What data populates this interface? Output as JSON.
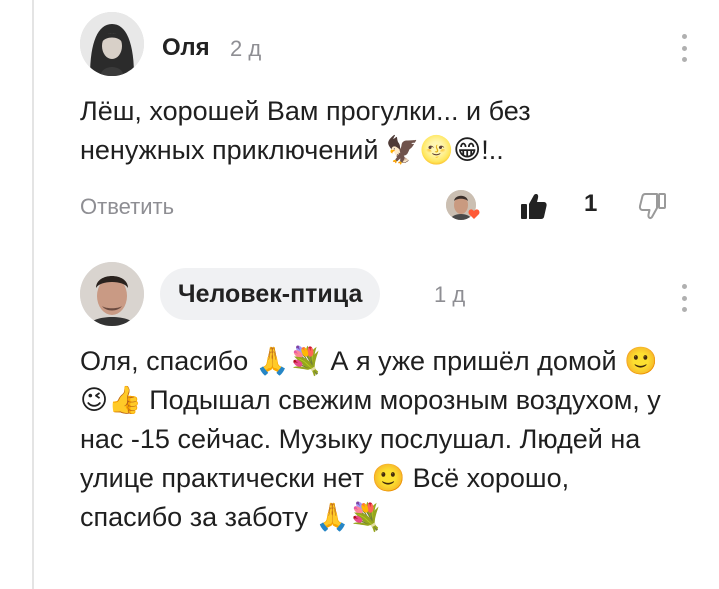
{
  "comments": [
    {
      "author": "Оля",
      "time": "2 д",
      "text": "Лёш, хорошей Вам прогулки... и без ненужных приключений 🦅🌝😁!..",
      "reply_label": "Ответить",
      "likes": "1"
    },
    {
      "author": "Человек-птица",
      "time": "1 д",
      "text": "Оля, спасибо 🙏💐 А я уже пришёл домой 🙂😉👍 Подышал свежим морозным воздухом, у нас -15 сейчас. Музыку послушал. Людей на улице практически нет 🙂 Всё хорошо, спасибо за заботу 🙏💐"
    }
  ],
  "icons": {
    "menu": "more-vertical-icon",
    "like": "thumbs-up-icon",
    "dislike": "thumbs-down-icon",
    "heart": "heart-icon"
  },
  "colors": {
    "text": "#1f1f1f",
    "muted": "#8e8e93",
    "pill": "#f0f1f3",
    "heart": "#ff5a36"
  }
}
